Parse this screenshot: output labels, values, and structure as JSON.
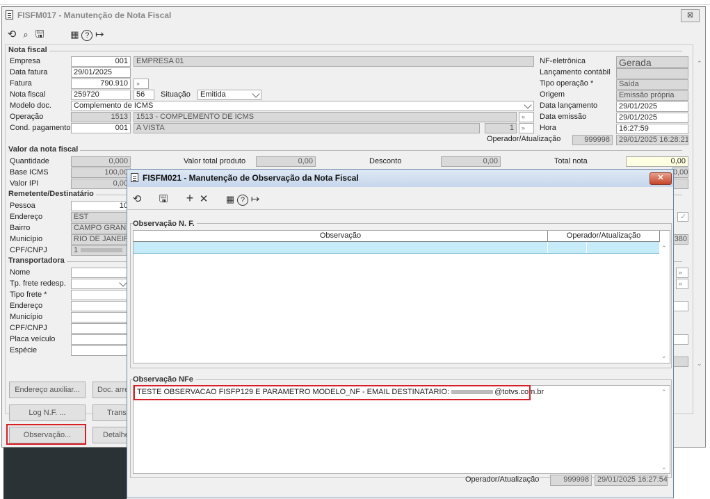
{
  "main_window": {
    "title": "FISFM017 - Manutenção de Nota Fiscal",
    "close_glyph": "⊠",
    "toolbar": {
      "undo": "⟲",
      "search": "🔍",
      "save": "🖫",
      "calendar": "📅",
      "help": "?",
      "exit": "↦"
    }
  },
  "nota_fiscal": {
    "section": "Nota fiscal",
    "empresa_label": "Empresa",
    "empresa_code": "001",
    "empresa_name": "EMPRESA 01",
    "data_fatura_label": "Data fatura",
    "data_fatura": "29/01/2025",
    "fatura_label": "Fatura",
    "fatura": "790.910",
    "nota_fiscal_label": "Nota fiscal",
    "nota_fiscal": "259720",
    "serie": "56",
    "situacao_label": "Situação",
    "situacao": "Emitida",
    "modelo_label": "Modelo doc.",
    "modelo": "Complemento de ICMS",
    "operacao_label": "Operação",
    "operacao_code": "1513",
    "operacao_desc": "1513 - COMPLEMENTO DE ICMS",
    "cond_label": "Cond. pagamento",
    "cond_code": "001",
    "cond_desc": "A VISTA",
    "cond_num": "1",
    "nfe_label": "NF-eletrônica",
    "nfe": "Gerada",
    "lanc_contabil_label": "Lançamento contábil",
    "tipo_op_label": "Tipo operação *",
    "tipo_op": "Saída",
    "origem_label": "Origem",
    "origem": "Emissão própria",
    "data_lanc_label": "Data lançamento",
    "data_lanc": "29/01/2025",
    "data_emissao_label": "Data emissão",
    "data_emissao": "29/01/2025",
    "hora_label": "Hora",
    "hora": "16:27:59",
    "operador_label": "Operador/Atualização",
    "operador": "999998",
    "atualizacao": "29/01/2025 16:28:21"
  },
  "valor": {
    "section": "Valor da nota fiscal",
    "quantidade_label": "Quantidade",
    "quantidade": "0,000",
    "base_icms_label": "Base ICMS",
    "base_icms": "100,00",
    "valor_ipi_label": "Valor IPI",
    "valor_ipi": "0,00",
    "valor_total_label": "Valor total produto",
    "valor_total": "0,00",
    "desconto_label": "Desconto",
    "desconto": "0,00",
    "total_nota_label": "Total nota",
    "total_nota": "0,00",
    "right_val": "0,00"
  },
  "remetente": {
    "section": "Remetente/Destinatário",
    "pessoa_label": "Pessoa",
    "pessoa": "10",
    "endereco_label": "Endereço",
    "endereco": "EST",
    "bairro_label": "Bairro",
    "bairro": "CAMPO GRAND",
    "municipio_label": "Município",
    "municipio": "RIO DE JANEIRO",
    "cpf_label": "CPF/CNPJ",
    "cpf": "1",
    "right_num": "380"
  },
  "transportadora": {
    "section": "Transportadora",
    "nome_label": "Nome",
    "tp_frete_label": "Tp. frete redesp.",
    "tipo_frete_label": "Tipo frete *",
    "endereco_label": "Endereço",
    "municipio_label": "Município",
    "cpf_label": "CPF/CNPJ",
    "placa_label": "Placa veículo",
    "especie_label": "Espécie"
  },
  "buttons": {
    "endereco_aux": "Endereço auxiliar...",
    "doc_arre": "Doc. arre",
    "log_nf": "Log N.F. ...",
    "trans": "Trans",
    "observacao": "Observação...",
    "detalhe": "Detalhe"
  },
  "modal": {
    "title": "FISFM021 - Manutenção de Observação da Nota Fiscal",
    "close_glyph": "✕",
    "toolbar": {
      "undo": "⟲",
      "save": "🖫",
      "add": "+",
      "delete": "✕",
      "calendar": "📅",
      "help": "?",
      "exit": "↦"
    },
    "obs_nf_section": "Observação N. F.",
    "col_observacao": "Observação",
    "col_operador": "Operador/Atualização",
    "obs_nfe_section": "Observação NFe",
    "obs_nfe_text": "TESTE OBSERVACAO FISFP129 E PARAMETRO MODELO_NF - EMAIL DESTINATARIO: ",
    "obs_nfe_email_domain": "@totvs.com.br",
    "operador_label": "Operador/Atualização",
    "operador": "999998",
    "atualizacao": "29/01/2025 16:27:54"
  }
}
